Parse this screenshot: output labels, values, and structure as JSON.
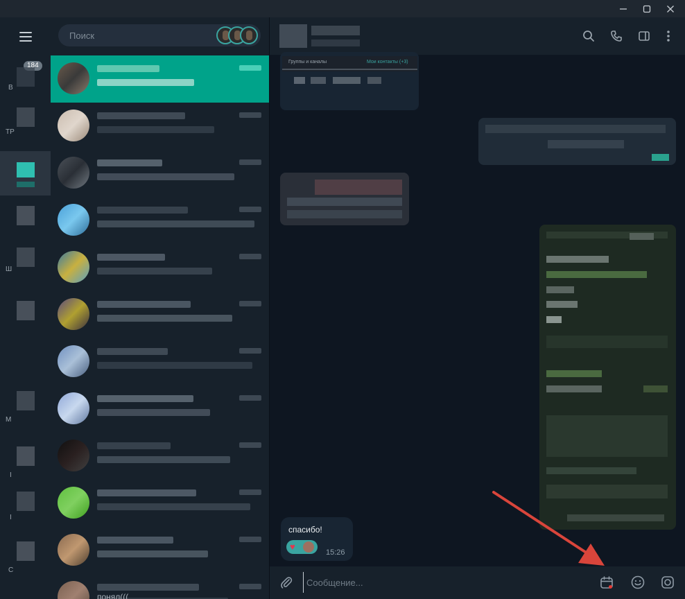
{
  "window": {
    "minimize_icon": "minimize-icon",
    "maximize_icon": "maximize-icon",
    "close_icon": "close-icon"
  },
  "folders": {
    "menu_icon": "hamburger-menu-icon",
    "unread_badge": "184",
    "labels": [
      "В",
      "ТР",
      "Ш",
      "М",
      "I",
      "I",
      "С"
    ]
  },
  "search": {
    "placeholder": "Поиск",
    "stories_count": 3
  },
  "chat_list": {
    "last_preview_text": "понял((("
  },
  "chat_header": {
    "icons": [
      "search-icon",
      "phone-icon",
      "sidebar-toggle-icon",
      "more-vertical-icon"
    ]
  },
  "shared_screenshot": {
    "tab_left": "Группы и каналы",
    "tab_right": "Мои контакты (+3)"
  },
  "last_message": {
    "text": "спасибо!",
    "time": "15:26",
    "reaction": "heart"
  },
  "composer": {
    "placeholder": "Сообщение...",
    "icons": [
      "paperclip-icon",
      "schedule-calendar-icon",
      "emoji-icon",
      "camera-icon"
    ]
  },
  "colors": {
    "accent": "#00a38a",
    "bg_dark": "#0e1621",
    "panel": "#17212b",
    "arrow": "#d9453b"
  }
}
